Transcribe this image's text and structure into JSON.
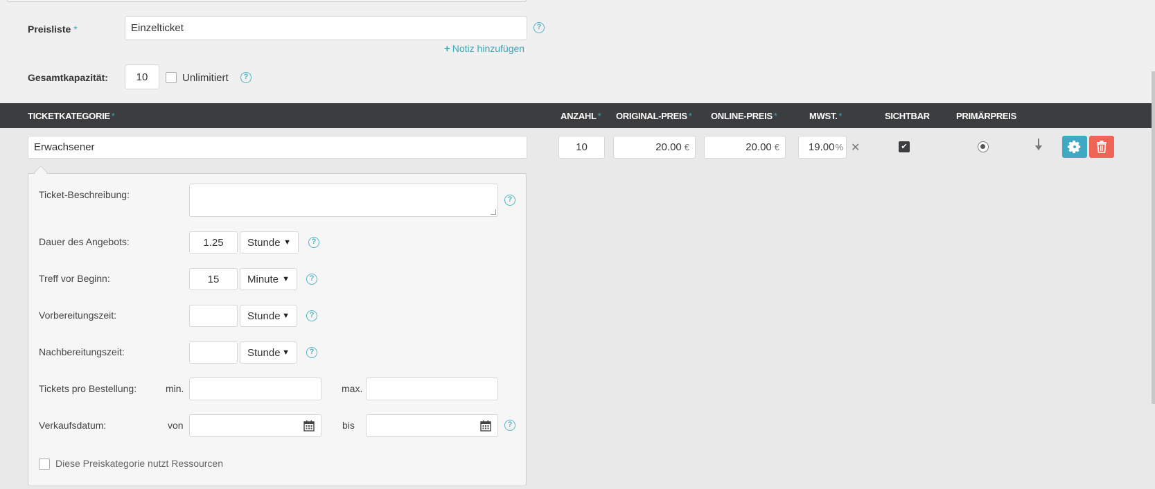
{
  "form": {
    "price_list_label": "Preisliste",
    "price_list_value": "Einzelticket",
    "add_note_link": "Notiz hinzufügen",
    "capacity_label": "Gesamtkapazität:",
    "capacity_value": "10",
    "unlimited_label": "Unlimitiert",
    "required_mark": "*"
  },
  "table": {
    "headers": {
      "category": "TICKETKATEGORIE",
      "count": "ANZAHL",
      "original_price": "ORIGINAL-PREIS",
      "online_price": "ONLINE-PREIS",
      "vat": "MWST.",
      "visible": "SICHTBAR",
      "primary": "PRIMÄRPREIS"
    },
    "row": {
      "category": "Erwachsener",
      "count": "10",
      "original_price": "20.00",
      "online_price": "20.00",
      "currency": "€",
      "vat": "19.00",
      "vat_unit": "%",
      "visible": true,
      "primary": true
    }
  },
  "details": {
    "description_label": "Ticket-Beschreibung:",
    "description_value": "",
    "duration_label": "Dauer des Angebots:",
    "duration_value": "1.25",
    "duration_unit": "Stunde",
    "meet_label": "Treff vor Beginn:",
    "meet_value": "15",
    "meet_unit": "Minute",
    "prep_label": "Vorbereitungszeit:",
    "prep_value": "",
    "prep_unit": "Stunde",
    "post_label": "Nachbereitungszeit:",
    "post_value": "",
    "post_unit": "Stunde",
    "per_order_label": "Tickets pro Bestellung:",
    "min_label": "min.",
    "max_label": "max.",
    "sale_date_label": "Verkaufsdatum:",
    "from_label": "von",
    "to_label": "bis",
    "resources_label": "Diese Preiskategorie nutzt Ressourcen"
  },
  "icons": {
    "help": "question-circle-icon",
    "settings": "gear-icon",
    "delete": "trash-icon",
    "calendar": "calendar-icon",
    "remove": "x-icon",
    "move": "arrow-down-icon"
  },
  "colors": {
    "accent": "#3aa8b8",
    "header_bg": "#3c3d3f",
    "settings_button": "#3fa9c4",
    "delete_button": "#ee6555"
  }
}
